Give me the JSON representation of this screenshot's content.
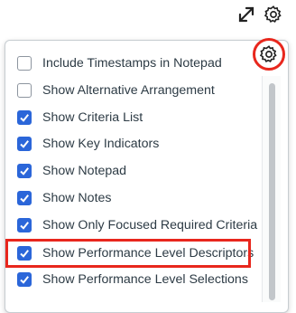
{
  "toolbar": {
    "expand_icon": "expand-arrows-icon",
    "settings_icon": "gear-icon"
  },
  "settings_menu": {
    "gear_icon": "gear-icon",
    "highlight_color": "#e8271d",
    "checkbox_color": "#2b66d9",
    "options": [
      {
        "label": "Include Timestamps in Notepad",
        "checked": false
      },
      {
        "label": "Show Alternative Arrangement",
        "checked": false
      },
      {
        "label": "Show Criteria List",
        "checked": true
      },
      {
        "label": "Show Key Indicators",
        "checked": true
      },
      {
        "label": "Show Notepad",
        "checked": true
      },
      {
        "label": "Show Notes",
        "checked": true
      },
      {
        "label": "Show Only Focused Required Criteria",
        "checked": true
      },
      {
        "label": "Show Performance Level Descriptors",
        "checked": true
      },
      {
        "label": "Show Performance Level Selections",
        "checked": true
      }
    ]
  }
}
